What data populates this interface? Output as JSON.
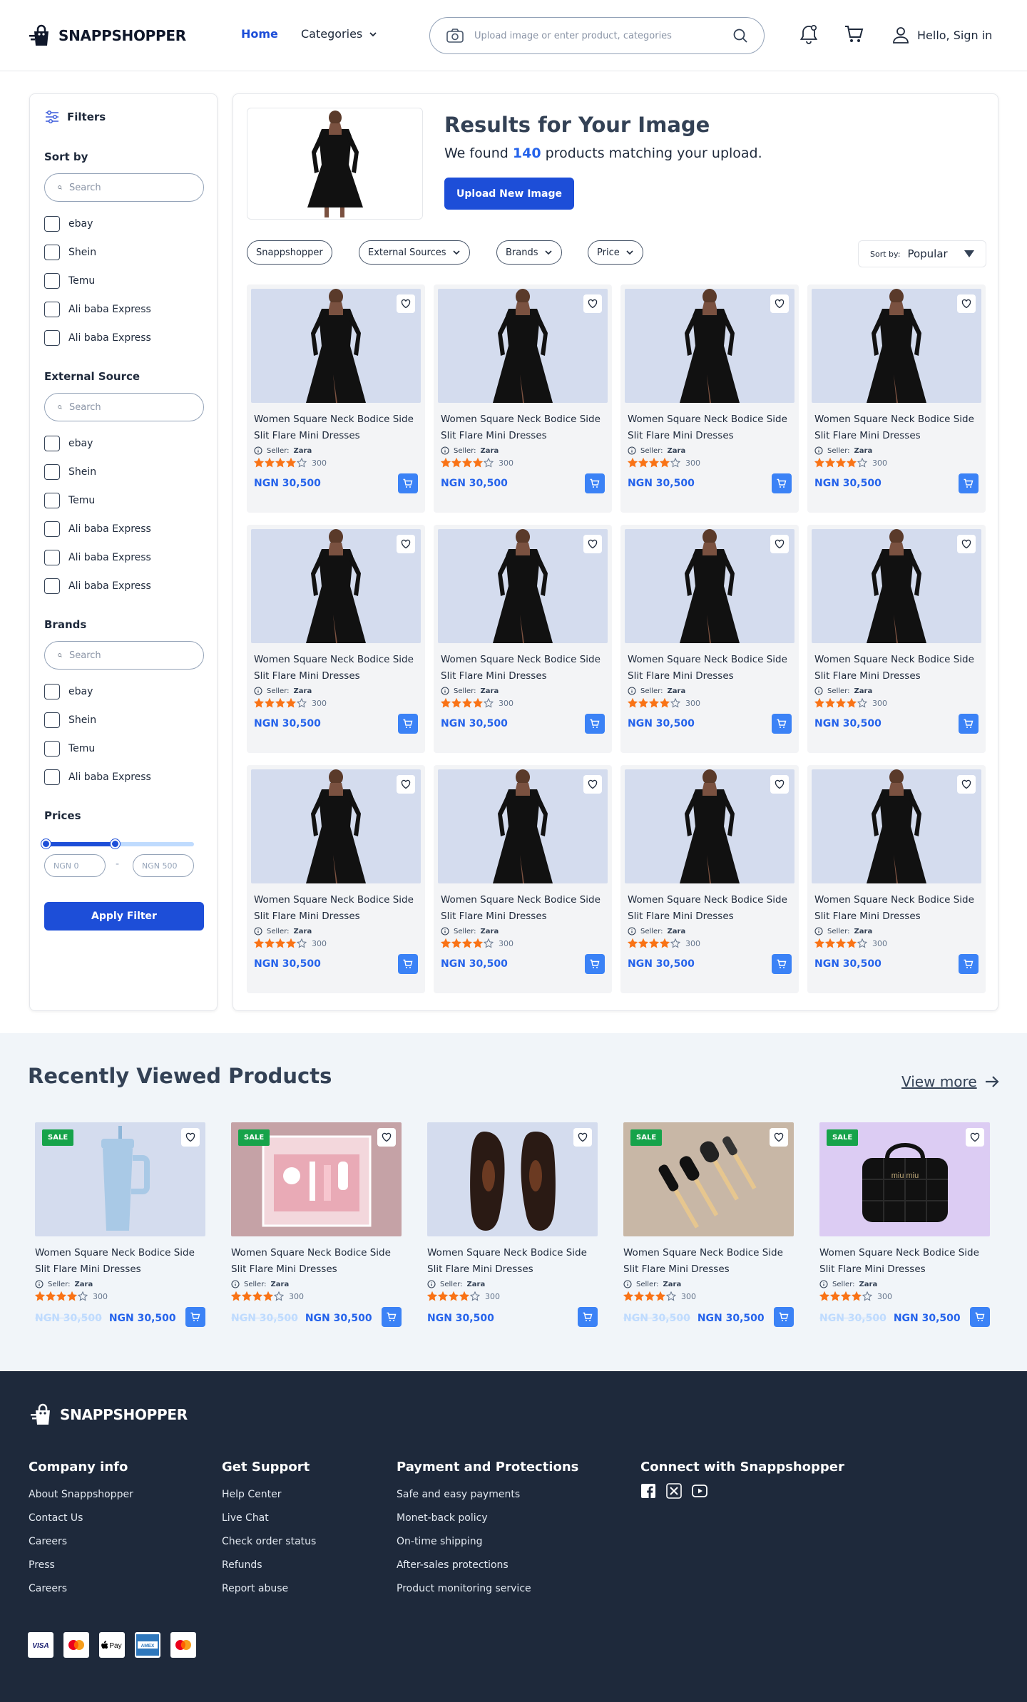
{
  "header": {
    "brand": "SNAPPSHOPPER",
    "nav_home": "Home",
    "nav_categories": "Categories",
    "search_placeholder": "Upload image or enter product, categories",
    "signin": "Hello, Sign in"
  },
  "filters": {
    "title": "Filters",
    "sort_by": {
      "title": "Sort by",
      "search_placeholder": "Search",
      "options": [
        "ebay",
        "Shein",
        "Temu",
        "Ali baba Express",
        "Ali baba Express"
      ]
    },
    "external_source": {
      "title": "External Source",
      "search_placeholder": "Search",
      "options": [
        "ebay",
        "Shein",
        "Temu",
        "Ali baba Express",
        "Ali baba Express",
        "Ali baba Express"
      ]
    },
    "brands": {
      "title": "Brands",
      "search_placeholder": "Search",
      "options": [
        "ebay",
        "Shein",
        "Temu",
        "Ali baba Express"
      ]
    },
    "prices": {
      "title": "Prices",
      "range_fraction": [
        0,
        0.47
      ],
      "min_placeholder": "NGN 0",
      "separator": "-",
      "max_placeholder": "NGN 500"
    },
    "apply_label": "Apply Filter"
  },
  "results": {
    "title": "Results for Your Image",
    "sub_prefix": "We found ",
    "count": "140",
    "sub_suffix": " products matching your upload.",
    "upload_label": "Upload New Image",
    "chips": [
      "Snappshopper",
      "External Sources",
      "Brands",
      "Price"
    ],
    "sort_label": "Sort by:",
    "sort_value": "Popular"
  },
  "products": [
    {
      "name": "Women Square Neck Bodice Side Slit Flare Mini Dresses",
      "seller_label": "Seller:",
      "seller": "Zara",
      "rating": 4,
      "reviews": "300",
      "price": "NGN 30,500"
    },
    {
      "name": "Women Square Neck Bodice Side Slit Flare Mini Dresses",
      "seller_label": "Seller:",
      "seller": "Zara",
      "rating": 4,
      "reviews": "300",
      "price": "NGN 30,500"
    },
    {
      "name": "Women Square Neck Bodice Side Slit Flare Mini Dresses",
      "seller_label": "Seller:",
      "seller": "Zara",
      "rating": 4,
      "reviews": "300",
      "price": "NGN 30,500"
    },
    {
      "name": "Women Square Neck Bodice Side Slit Flare Mini Dresses",
      "seller_label": "Seller:",
      "seller": "Zara",
      "rating": 4,
      "reviews": "300",
      "price": "NGN 30,500"
    },
    {
      "name": "Women Square Neck Bodice Side Slit Flare Mini Dresses",
      "seller_label": "Seller:",
      "seller": "Zara",
      "rating": 4,
      "reviews": "300",
      "price": "NGN 30,500"
    },
    {
      "name": "Women Square Neck Bodice Side Slit Flare Mini Dresses",
      "seller_label": "Seller:",
      "seller": "Zara",
      "rating": 4,
      "reviews": "300",
      "price": "NGN 30,500"
    },
    {
      "name": "Women Square Neck Bodice Side Slit Flare Mini Dresses",
      "seller_label": "Seller:",
      "seller": "Zara",
      "rating": 4,
      "reviews": "300",
      "price": "NGN 30,500"
    },
    {
      "name": "Women Square Neck Bodice Side Slit Flare Mini Dresses",
      "seller_label": "Seller:",
      "seller": "Zara",
      "rating": 4,
      "reviews": "300",
      "price": "NGN 30,500"
    },
    {
      "name": "Women Square Neck Bodice Side Slit Flare Mini Dresses",
      "seller_label": "Seller:",
      "seller": "Zara",
      "rating": 4,
      "reviews": "300",
      "price": "NGN 30,500"
    },
    {
      "name": "Women Square Neck Bodice Side Slit Flare Mini Dresses",
      "seller_label": "Seller:",
      "seller": "Zara",
      "rating": 4,
      "reviews": "300",
      "price": "NGN 30,500"
    },
    {
      "name": "Women Square Neck Bodice Side Slit Flare Mini Dresses",
      "seller_label": "Seller:",
      "seller": "Zara",
      "rating": 4,
      "reviews": "300",
      "price": "NGN 30,500"
    },
    {
      "name": "Women Square Neck Bodice Side Slit Flare Mini Dresses",
      "seller_label": "Seller:",
      "seller": "Zara",
      "rating": 4,
      "reviews": "300",
      "price": "NGN 30,500"
    }
  ],
  "recent": {
    "title": "Recently Viewed Products",
    "view_more": "View more",
    "items": [
      {
        "sale": "SALE",
        "image": "tumbler",
        "bg": "#d4dcee",
        "name": "Women Square Neck Bodice Side Slit Flare Mini Dresses",
        "seller_label": "Seller:",
        "seller": "Zara",
        "rating": 4,
        "reviews": "300",
        "old_price": "NGN 30,500",
        "price": "NGN 30,500"
      },
      {
        "sale": "SALE",
        "image": "baby-care-kit",
        "bg": "#c5a2a6",
        "name": "Women Square Neck Bodice Side Slit Flare Mini Dresses",
        "seller_label": "Seller:",
        "seller": "Zara",
        "rating": 4,
        "reviews": "300",
        "old_price": "NGN 30,500",
        "price": "NGN 30,500"
      },
      {
        "sale": "",
        "image": "shoes",
        "bg": "#d4dcee",
        "name": "Women Square Neck Bodice Side Slit Flare Mini Dresses",
        "seller_label": "Seller:",
        "seller": "Zara",
        "rating": 4,
        "reviews": "300",
        "old_price": "",
        "price": "NGN 30,500"
      },
      {
        "sale": "SALE",
        "image": "brushes",
        "bg": "#c8b7a6",
        "name": "Women Square Neck Bodice Side Slit Flare Mini Dresses",
        "seller_label": "Seller:",
        "seller": "Zara",
        "rating": 4,
        "reviews": "300",
        "old_price": "NGN 30,500",
        "price": "NGN 30,500"
      },
      {
        "sale": "SALE",
        "image": "handbag",
        "bg": "#dcccf3",
        "name": "Women Square Neck Bodice Side Slit Flare Mini Dresses",
        "seller_label": "Seller:",
        "seller": "Zara",
        "rating": 4,
        "reviews": "300",
        "old_price": "NGN 30,500",
        "price": "NGN 30,500"
      }
    ]
  },
  "footer": {
    "brand": "SNAPPSHOPPER",
    "columns": [
      {
        "title": "Company info",
        "links": [
          "About Snappshopper",
          "Contact Us",
          "Careers",
          "Press",
          "Careers"
        ]
      },
      {
        "title": "Get Support",
        "links": [
          "Help Center",
          "Live Chat",
          "Check order status",
          "Refunds",
          "Report abuse"
        ]
      },
      {
        "title": "Payment and Protections",
        "links": [
          "Safe and easy payments",
          "Monet-back policy",
          "On-time shipping",
          "After-sales protections",
          "Product monitoring service"
        ]
      },
      {
        "title": "Connect with Snappshopper",
        "links": []
      }
    ],
    "social_icons": [
      "facebook-icon",
      "x-icon",
      "youtube-icon"
    ],
    "payment_methods": [
      "visa",
      "mastercard",
      "apple-pay",
      "american-express",
      "mastercard"
    ]
  },
  "colors": {
    "accent": "#1d4ed8",
    "price": "#2563eb",
    "star": "#f97316",
    "sale": "#16a34a",
    "footer_bg": "#1e293b"
  }
}
